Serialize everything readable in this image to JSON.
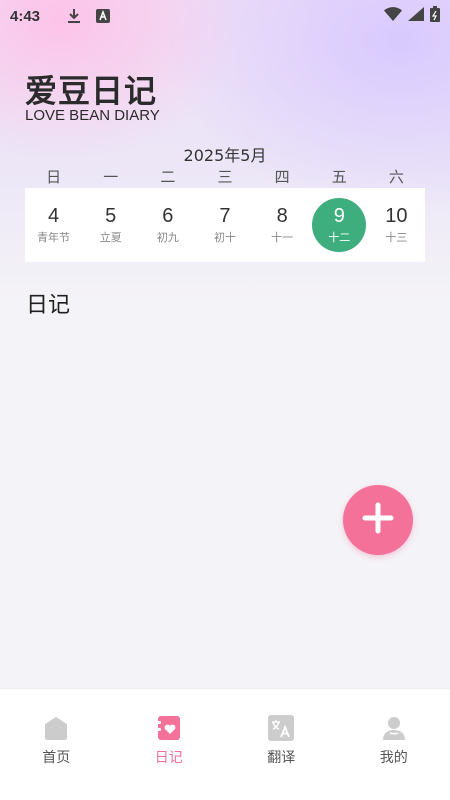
{
  "status_bar": {
    "time": "4:43",
    "icons": [
      "download-icon",
      "a-icon"
    ],
    "right_icons": [
      "wifi-icon",
      "signal-icon",
      "battery-icon"
    ]
  },
  "header": {
    "title": "爱豆日记",
    "subtitle": "LOVE BEAN DIARY"
  },
  "calendar": {
    "month": "2025年5月",
    "weekdays": [
      "日",
      "一",
      "二",
      "三",
      "四",
      "五",
      "六"
    ],
    "days": [
      {
        "num": "4",
        "lunar": "青年节"
      },
      {
        "num": "5",
        "lunar": "立夏"
      },
      {
        "num": "6",
        "lunar": "初九"
      },
      {
        "num": "7",
        "lunar": "初十"
      },
      {
        "num": "8",
        "lunar": "十一"
      },
      {
        "num": "9",
        "lunar": "十二"
      },
      {
        "num": "10",
        "lunar": "十三"
      }
    ],
    "selected_index": 5,
    "selected_color": "#3fae7e"
  },
  "section": {
    "title": "日记"
  },
  "fab": {
    "icon": "plus-icon",
    "color": "#f4719a"
  },
  "bottom_nav": {
    "items": [
      {
        "label": "首页",
        "icon": "home-icon"
      },
      {
        "label": "日记",
        "icon": "diary-icon"
      },
      {
        "label": "翻译",
        "icon": "translate-icon"
      },
      {
        "label": "我的",
        "icon": "profile-icon"
      }
    ],
    "active_index": 1,
    "active_color": "#f4719a",
    "inactive_color": "#cccccc"
  }
}
